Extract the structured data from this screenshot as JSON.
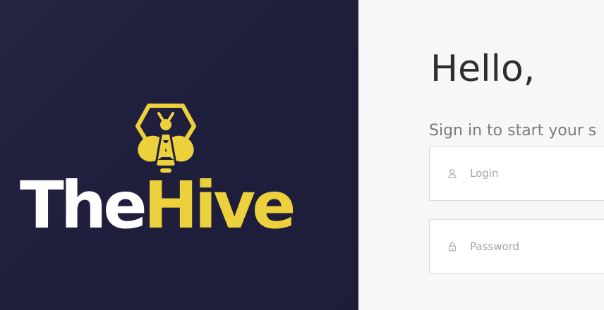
{
  "brand": {
    "name_part1": "The",
    "name_part2": "Hive",
    "logo_icon": "bee-hexagon-icon",
    "colors": {
      "panel_background": "#1f1f3d",
      "accent_yellow": "#ecd13d",
      "wordmark_white": "#ffffff"
    }
  },
  "login": {
    "greeting": "Hello,",
    "subtitle": "Sign in to start your s",
    "login_field": {
      "placeholder": "Login",
      "value": "",
      "icon": "user-icon"
    },
    "password_field": {
      "placeholder": "Password",
      "value": "",
      "icon": "lock-icon"
    },
    "colors": {
      "panel_background": "#f7f7f7",
      "greeting_text": "#2e2e2e",
      "subtitle_text": "#7b7b7b",
      "placeholder_text": "#a5a5a5"
    }
  }
}
